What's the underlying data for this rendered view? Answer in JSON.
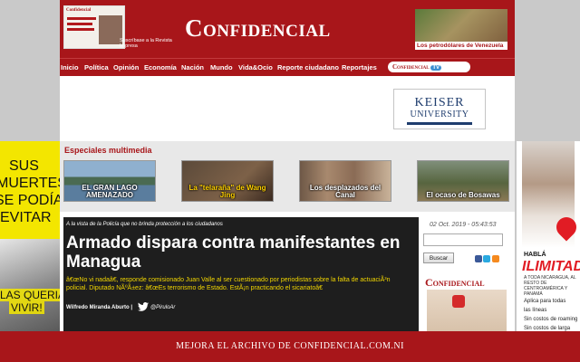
{
  "header": {
    "logo": "Confidencial",
    "magazine_masthead": "Confidencial",
    "subscribe_text": "Suscríbase a la Revista Impresa",
    "banner_caption": "Los petrodólares de Venezuela"
  },
  "nav": {
    "items": [
      "Inicio",
      "Política",
      "Opinión",
      "Economía",
      "Nación",
      "Mundo",
      "Vida&Ocio",
      "Reporte ciudadano",
      "Reportajes"
    ],
    "tv_logo": "Confidencial",
    "tv_badge": "TV"
  },
  "ads": {
    "keiser_line1": "KEISER",
    "keiser_line2": "UNIVERSITY"
  },
  "multimedia": {
    "title": "Especiales multimedia",
    "items": [
      {
        "caption": "EL GRAN LAGO AMENAZADO"
      },
      {
        "caption": "La \"telaraña\" de Wang Jing"
      },
      {
        "caption": "Los desplazados del Canal"
      },
      {
        "caption": "El ocaso de Bosawas"
      }
    ]
  },
  "side_left": {
    "lines": [
      "SUS",
      "MUERTES",
      "SE PODÍAN",
      "EVITAR"
    ],
    "bottom_lines": [
      "LAS QUERIAN",
      "VIVIR!"
    ]
  },
  "side_right": {
    "line1": "HABLÁ",
    "line2": "ILIMITADO",
    "line3": "A TODA NICARAGUA, AL RESTO DE CENTROAMÉRICA Y PANAMÁ",
    "items": [
      "Aplica para todas",
      "las líneas",
      "Sin costos de roaming",
      "Sin costos de larga"
    ]
  },
  "article": {
    "kicker": "A la vista de la Policía que no brinda protección a los ciudadanos",
    "headline": "Armado dispara contra manifestantes en Managua",
    "summary": "â€œNo vi nadaâ€, responde comisionado Juan Valle al ser cuestionado por periodistas sobre la falta de actuaciÃ³n policial. Diputado NÃºÃ±ez: â€œEs terrorismo de Estado. EstÃ¡n practicando el sicariatoâ€",
    "byline": "Wilfredo Miranda Aburto",
    "separator": "|",
    "twitter_handle": "@PiruloAr"
  },
  "sidebar": {
    "date": "02 Oct. 2019 - 05:43:53",
    "search_button": "Buscar",
    "search_placeholder": "",
    "promo_title": "Confidencial"
  },
  "footer": {
    "text": "MEJORA EL ARCHIVO DE CONFIDENCIAL.COM.NI"
  }
}
